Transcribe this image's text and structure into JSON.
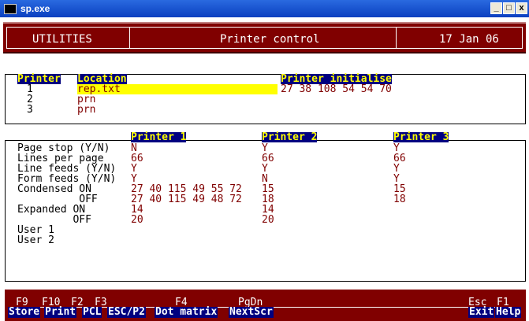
{
  "window": {
    "title": "sp.exe",
    "btn_min": "_",
    "btn_max": "□",
    "btn_close": "x"
  },
  "header": {
    "left": "UTILITIES",
    "center": "Printer control",
    "right": "17 Jan 06"
  },
  "printers_table": {
    "col_printer": "Printer",
    "col_location": "Location",
    "col_init": "Printer initialise",
    "rows": [
      {
        "num": "1",
        "location": "rep.txt",
        "init": "27 38 108 54 54 70"
      },
      {
        "num": "2",
        "location": "prn",
        "init": ""
      },
      {
        "num": "3",
        "location": "prn",
        "init": ""
      }
    ]
  },
  "settings": {
    "columns": [
      "Printer 1",
      "Printer 2",
      "Printer 3"
    ],
    "rows": [
      {
        "label": "Page stop (Y/N)",
        "p1": "N",
        "p2": "Y",
        "p3": "Y"
      },
      {
        "label": "Lines per page",
        "p1": "66",
        "p2": "66",
        "p3": "66"
      },
      {
        "label": "Line feeds (Y/N)",
        "p1": "Y",
        "p2": "Y",
        "p3": "Y"
      },
      {
        "label": "Form feeds (Y/N)",
        "p1": "Y",
        "p2": "N",
        "p3": "Y"
      },
      {
        "label": "Condensed ON",
        "p1": "27 40 115 49 55 72",
        "p2": "15",
        "p3": "15"
      },
      {
        "label": "          OFF",
        "p1": "27 40 115 49 48 72",
        "p2": "18",
        "p3": "18"
      },
      {
        "label": "Expanded ON",
        "p1": "14",
        "p2": "14",
        "p3": ""
      },
      {
        "label": "         OFF",
        "p1": "20",
        "p2": "20",
        "p3": ""
      },
      {
        "label": "User 1",
        "p1": "",
        "p2": "",
        "p3": ""
      },
      {
        "label": "User 2",
        "p1": "",
        "p2": "",
        "p3": ""
      }
    ]
  },
  "footer": {
    "keys": [
      {
        "key": "F9",
        "label": "Store"
      },
      {
        "key": "F10",
        "label": "Print"
      },
      {
        "key": "F2",
        "label": "PCL"
      },
      {
        "key": "F3",
        "label": "ESC/P2"
      },
      {
        "key": "F4",
        "label": "Dot matrix"
      },
      {
        "key": "PgDn",
        "label": "NextScr"
      },
      {
        "key": "Esc",
        "label": "Exit"
      },
      {
        "key": "F1",
        "label": "Help"
      }
    ]
  },
  "colors": {
    "maroon": "#800000",
    "navy": "#000080",
    "yellow": "#ffff00",
    "titlebar": "#0a3fc0"
  }
}
